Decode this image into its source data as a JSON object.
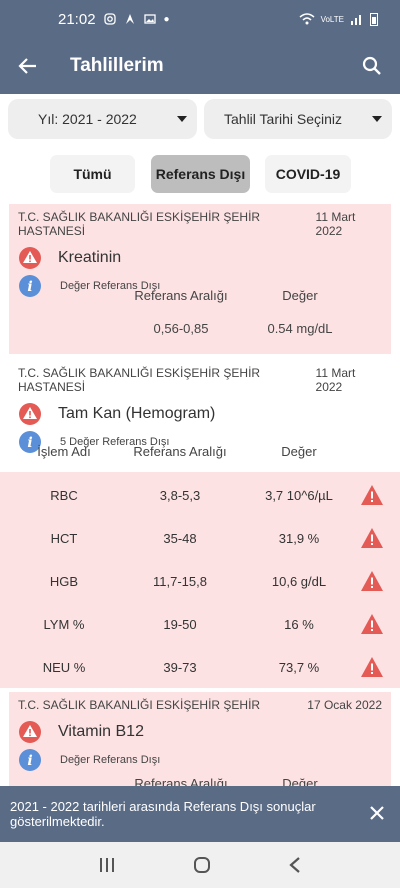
{
  "status": {
    "time": "21:02",
    "network": "VoLTE",
    "signal": "LTE1"
  },
  "app": {
    "title": "Tahlillerim"
  },
  "filters": {
    "year": "Yıl: 2021 - 2022",
    "date": "Tahlil Tarihi Seçiniz"
  },
  "tabs": [
    {
      "label": "Tümü"
    },
    {
      "label": "Referans Dışı"
    },
    {
      "label": "COVID-19"
    }
  ],
  "cards": [
    {
      "hospital": "T.C. SAĞLIK BAKANLIĞI ESKİŞEHİR ŞEHİR HASTANESİ",
      "date": "11 Mart 2022",
      "test": "Kreatinin",
      "info": "Değer Referans Dışı",
      "ref_header": "Referans Aralığı",
      "val_header": "Değer",
      "ref_value": "0,56-0,85",
      "value": "0.54 mg/dL"
    },
    {
      "hospital": "T.C. SAĞLIK BAKANLIĞI ESKİŞEHİR ŞEHİR HASTANESİ",
      "date": "11 Mart 2022",
      "test": "Tam Kan (Hemogram)",
      "info": "5 Değer Referans Dışı",
      "name_header": "İşlem Adı",
      "ref_header": "Referans Aralığı",
      "val_header": "Değer",
      "rows": [
        {
          "name": "RBC",
          "ref": "3,8-5,3",
          "value": "3,7 10^6/µL"
        },
        {
          "name": "HCT",
          "ref": "35-48",
          "value": "31,9 %"
        },
        {
          "name": "HGB",
          "ref": "11,7-15,8",
          "value": "10,6 g/dL"
        },
        {
          "name": "LYM %",
          "ref": "19-50",
          "value": "16 %"
        },
        {
          "name": "NEU %",
          "ref": "39-73",
          "value": "73,7 %"
        }
      ]
    },
    {
      "hospital": "T.C. SAĞLIK BAKANLIĞI ESKİŞEHİR ŞEHİR",
      "date": "17 Ocak 2022",
      "test": "Vitamin B12",
      "info": "Değer Referans Dışı",
      "ref_header": "Referans Aralığı",
      "val_header": "Değer"
    }
  ],
  "snackbar": {
    "message": "2021 - 2022 tarihleri arasında Referans Dışı sonuçlar gösterilmektedir."
  },
  "colors": {
    "primary": "#5a6b86",
    "warning": "#e45a55",
    "info": "#5b8fd8",
    "highlight": "#fde2e3"
  }
}
